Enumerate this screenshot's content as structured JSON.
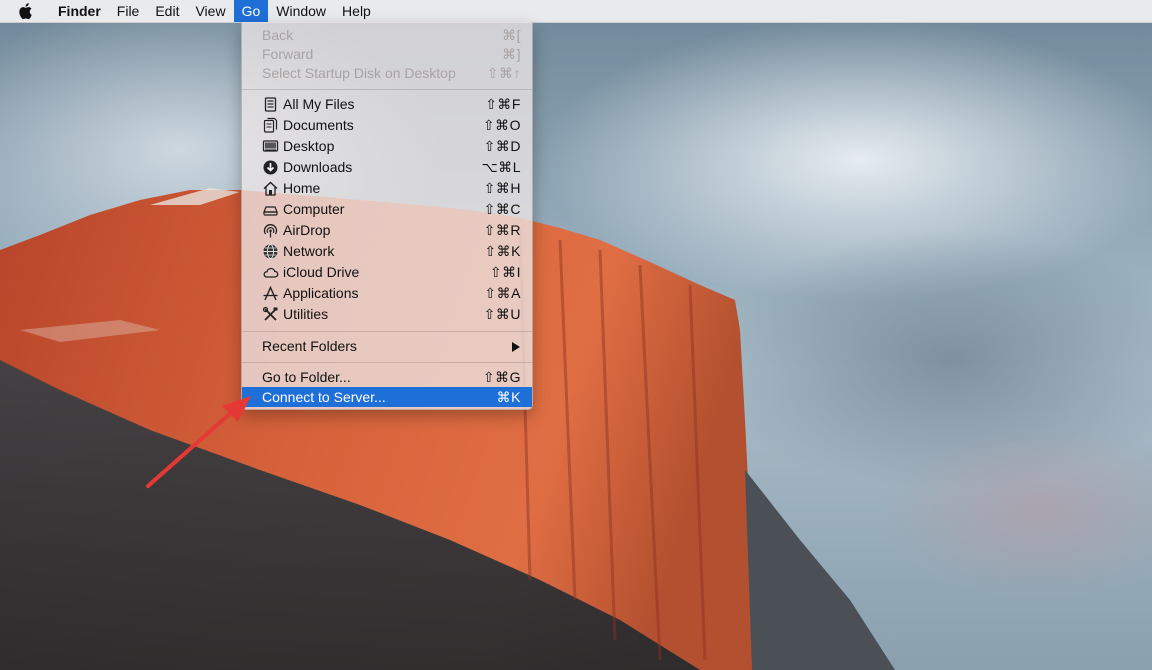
{
  "menubar": {
    "items": [
      {
        "label": "Finder"
      },
      {
        "label": "File"
      },
      {
        "label": "Edit"
      },
      {
        "label": "View"
      },
      {
        "label": "Go"
      },
      {
        "label": "Window"
      },
      {
        "label": "Help"
      }
    ],
    "active_item": "Go"
  },
  "go_menu": {
    "navigation": [
      {
        "label": "Back",
        "shortcut": "⌘[",
        "enabled": false
      },
      {
        "label": "Forward",
        "shortcut": "⌘]",
        "enabled": false
      },
      {
        "label": "Select Startup Disk on Desktop",
        "shortcut": "⇧⌘↑",
        "enabled": false
      }
    ],
    "locations": [
      {
        "label": "All My Files",
        "shortcut": "⇧⌘F",
        "icon": "all-files-icon"
      },
      {
        "label": "Documents",
        "shortcut": "⇧⌘O",
        "icon": "documents-icon"
      },
      {
        "label": "Desktop",
        "shortcut": "⇧⌘D",
        "icon": "desktop-icon"
      },
      {
        "label": "Downloads",
        "shortcut": "⌥⌘L",
        "icon": "downloads-icon"
      },
      {
        "label": "Home",
        "shortcut": "⇧⌘H",
        "icon": "home-icon"
      },
      {
        "label": "Computer",
        "shortcut": "⇧⌘C",
        "icon": "computer-icon"
      },
      {
        "label": "AirDrop",
        "shortcut": "⇧⌘R",
        "icon": "airdrop-icon"
      },
      {
        "label": "Network",
        "shortcut": "⇧⌘K",
        "icon": "network-icon"
      },
      {
        "label": "iCloud Drive",
        "shortcut": "⇧⌘I",
        "icon": "icloud-icon"
      },
      {
        "label": "Applications",
        "shortcut": "⇧⌘A",
        "icon": "applications-icon"
      },
      {
        "label": "Utilities",
        "shortcut": "⇧⌘U",
        "icon": "utilities-icon"
      }
    ],
    "recent_folders": {
      "label": "Recent Folders"
    },
    "go_to_folder": {
      "label": "Go to Folder...",
      "shortcut": "⇧⌘G"
    },
    "connect_to_server": {
      "label": "Connect to Server...",
      "shortcut": "⌘K",
      "highlighted": true
    }
  },
  "colors": {
    "highlight": "#1f6fd9",
    "annotation_arrow": "#e53935"
  }
}
